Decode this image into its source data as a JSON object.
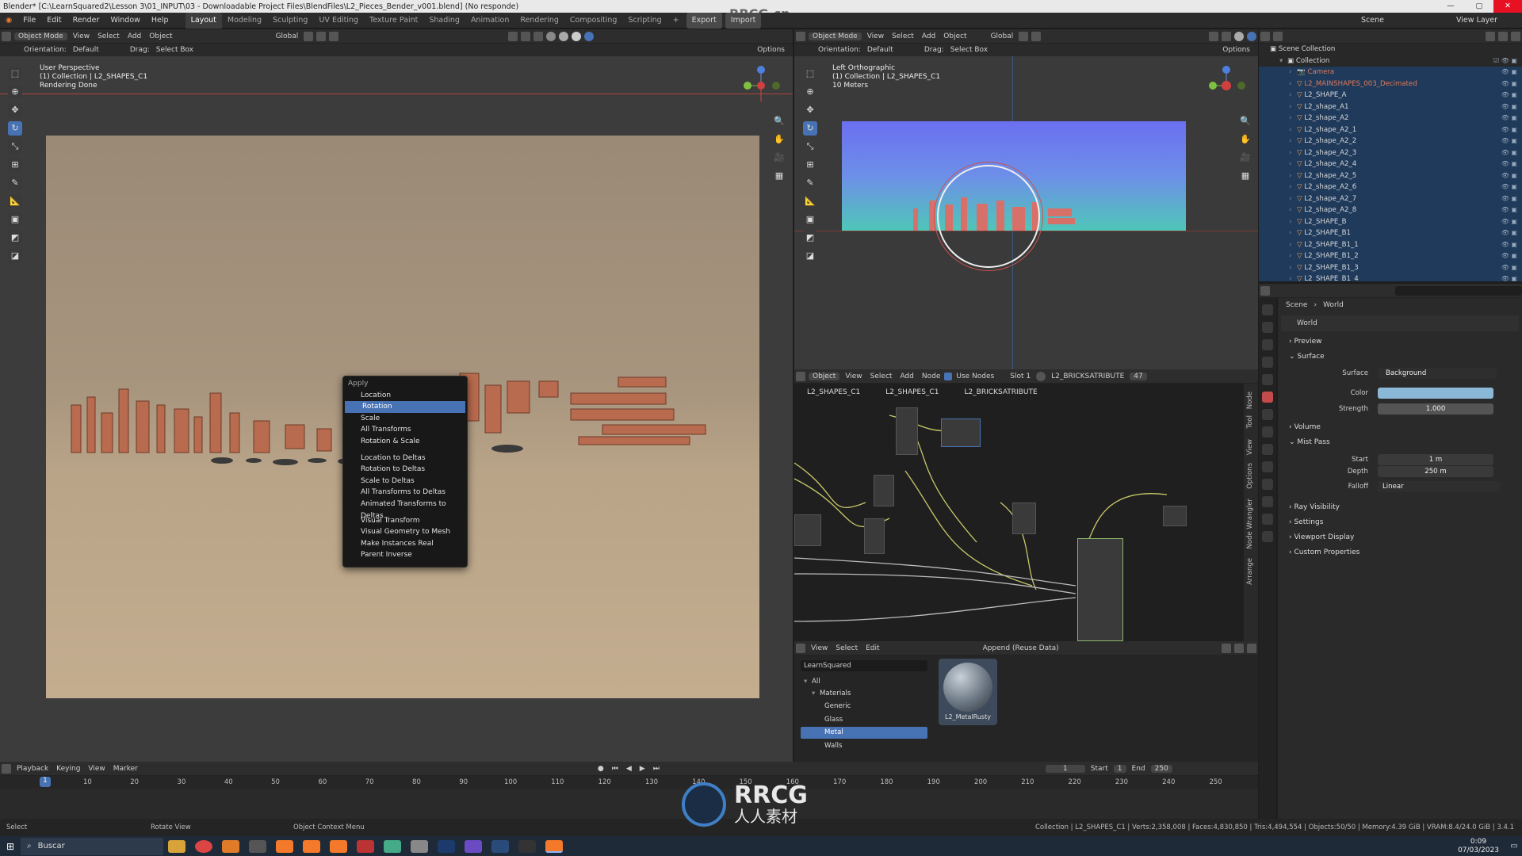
{
  "window": {
    "title": "Blender* [C:\\LearnSquared2\\Lesson 3\\01_INPUT\\03 - Downloadable Project Files\\BlendFiles\\L2_Pieces_Bender_v001.blend] (No responde)",
    "close": "✕",
    "min": "—",
    "max": "▢"
  },
  "watermark": "RRCG.cn",
  "topbar": {
    "menus": [
      "File",
      "Edit",
      "Render",
      "Window",
      "Help"
    ],
    "workspaces": [
      "Layout",
      "Modeling",
      "Sculpting",
      "UV Editing",
      "Texture Paint",
      "Shading",
      "Animation",
      "Rendering",
      "Compositing",
      "Scripting"
    ],
    "active_workspace": "Layout",
    "add": "+",
    "export": "Export",
    "import": "Import",
    "scene": "Scene",
    "view_layer": "View Layer"
  },
  "vp1": {
    "mode": "Object Mode",
    "menus": [
      "View",
      "Select",
      "Add",
      "Object"
    ],
    "transform": "Global",
    "orientation_label": "Orientation:",
    "orientation": "Default",
    "drag_label": "Drag:",
    "drag": "Select Box",
    "options": "Options",
    "overlay": [
      "User Perspective",
      "(1) Collection | L2_SHAPES_C1",
      "Rendering Done"
    ]
  },
  "context_menu": {
    "title": "Apply",
    "selected": "Rotation",
    "groups": [
      [
        "Location",
        "Rotation",
        "Scale",
        "All Transforms",
        "Rotation & Scale"
      ],
      [
        "Location to Deltas",
        "Rotation to Deltas",
        "Scale to Deltas",
        "All Transforms to Deltas",
        "Animated Transforms to Deltas"
      ],
      [
        "Visual Transform",
        "Visual Geometry to Mesh",
        "Make Instances Real",
        "Parent Inverse"
      ]
    ]
  },
  "vp2": {
    "mode": "Object Mode",
    "menus": [
      "View",
      "Select",
      "Add",
      "Object"
    ],
    "transform": "Global",
    "orientation_label": "Orientation:",
    "orientation": "Default",
    "drag_label": "Drag:",
    "drag": "Select Box",
    "options": "Options",
    "overlay": [
      "Left Orthographic",
      "(1) Collection | L2_SHAPES_C1",
      "10 Meters"
    ]
  },
  "node_editor": {
    "object": "Object",
    "menus": [
      "View",
      "Select",
      "Add",
      "Node"
    ],
    "use_nodes": "Use Nodes",
    "slot": "Slot 1",
    "material": "L2_BRICKSATRIBUTE",
    "users": "47",
    "breadcrumb": [
      "L2_SHAPES_C1",
      "L2_SHAPES_C1",
      "L2_BRICKSATRIBUTE"
    ],
    "side_tabs": [
      "Node",
      "Tool",
      "View",
      "Options",
      "Node Wrangler",
      "Arrange"
    ]
  },
  "asset_browser": {
    "menus": [
      "View",
      "Select",
      "Edit"
    ],
    "import_method": "Append (Reuse Data)",
    "library": "LearnSquared",
    "tree": [
      {
        "label": "All",
        "level": 0,
        "exp": "▾"
      },
      {
        "label": "Materials",
        "level": 1,
        "exp": "▾"
      },
      {
        "label": "Generic",
        "level": 2
      },
      {
        "label": "Glass",
        "level": 2
      },
      {
        "label": "Metal",
        "level": 2,
        "active": true
      },
      {
        "label": "Walls",
        "level": 2
      }
    ],
    "asset_name": "L2_MetalRusty"
  },
  "outliner": {
    "root": "Scene Collection",
    "collection": "Collection",
    "items": [
      "Camera",
      "L2_MAINSHAPES_003_Decimated",
      "L2_SHAPE_A",
      "L2_shape_A1",
      "L2_shape_A2",
      "L2_shape_A2_1",
      "L2_shape_A2_2",
      "L2_shape_A2_3",
      "L2_shape_A2_4",
      "L2_shape_A2_5",
      "L2_shape_A2_6",
      "L2_shape_A2_7",
      "L2_shape_A2_8",
      "L2_SHAPE_B",
      "L2_SHAPE_B1",
      "L2_SHAPE_B1_1",
      "L2_SHAPE_B1_2",
      "L2_SHAPE_B1_3",
      "L2_SHAPE_B1_4"
    ]
  },
  "properties": {
    "crumbs": [
      "Scene",
      "World"
    ],
    "world_name": "World",
    "sections": {
      "preview": "Preview",
      "surface": "Surface",
      "volume": "Volume",
      "mist": "Mist Pass",
      "ray": "Ray Visibility",
      "settings": "Settings",
      "viewport": "Viewport Display",
      "custom": "Custom Properties"
    },
    "surface_label": "Surface",
    "surface_value": "Background",
    "color_label": "Color",
    "color": "#8cb8d8",
    "strength_label": "Strength",
    "strength": "1.000",
    "mist_start_label": "Start",
    "mist_start": "1 m",
    "mist_depth_label": "Depth",
    "mist_depth": "250 m",
    "falloff_label": "Falloff",
    "falloff": "Linear"
  },
  "timeline": {
    "menus": [
      "Playback",
      "Keying",
      "View",
      "Marker"
    ],
    "current_frame": "1",
    "start_label": "Start",
    "start": "1",
    "end_label": "End",
    "end": "250",
    "ticks": [
      "1",
      "10",
      "20",
      "30",
      "40",
      "50",
      "60",
      "70",
      "80",
      "90",
      "100",
      "110",
      "120",
      "130",
      "140",
      "150",
      "160",
      "170",
      "180",
      "190",
      "200",
      "210",
      "220",
      "230",
      "240",
      "250"
    ]
  },
  "statusbar": {
    "left": "Select",
    "mid1": "Rotate View",
    "mid2": "Object Context Menu",
    "right": "Collection | L2_SHAPES_C1 | Verts:2,358,008 | Faces:4,830,850 | Tris:4,494,554 | Objects:50/50 | Memory:4.39 GiB | VRAM:8.4/24.0 GiB | 3.4.1"
  },
  "taskbar": {
    "search": "Buscar",
    "time": "0:09",
    "date": "07/03/2023"
  },
  "logo": {
    "brand": "RRCG",
    "sub": "人人素材"
  }
}
